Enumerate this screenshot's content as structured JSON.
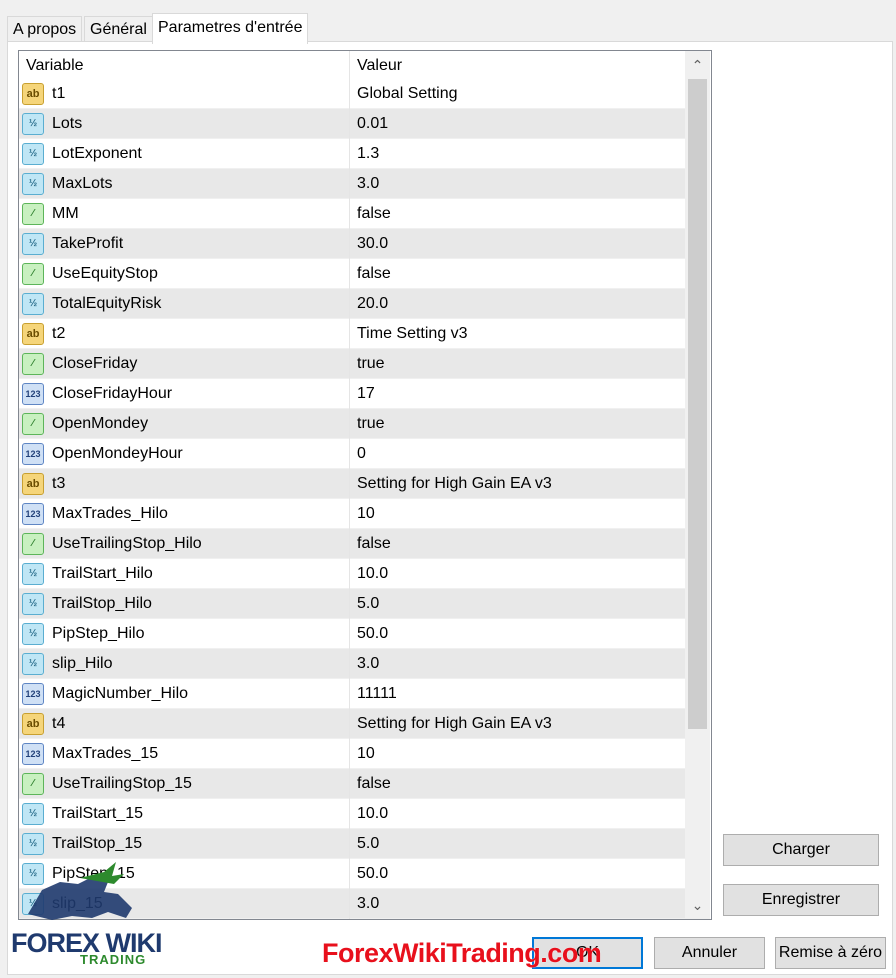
{
  "tabs": [
    {
      "label": "A propos"
    },
    {
      "label": "Général"
    },
    {
      "label": "Parametres d'entrée",
      "active": true
    }
  ],
  "grid": {
    "headers": {
      "variable": "Variable",
      "value": "Valeur"
    },
    "rows": [
      {
        "type": "string",
        "icon": "ab",
        "name": "t1",
        "value": "Global Setting"
      },
      {
        "type": "double",
        "icon": "½",
        "name": "Lots",
        "value": "0.01"
      },
      {
        "type": "double",
        "icon": "½",
        "name": "LotExponent",
        "value": "1.3"
      },
      {
        "type": "double",
        "icon": "½",
        "name": "MaxLots",
        "value": "3.0"
      },
      {
        "type": "bool",
        "icon": "⁄",
        "name": "MM",
        "value": "false"
      },
      {
        "type": "double",
        "icon": "½",
        "name": "TakeProfit",
        "value": "30.0"
      },
      {
        "type": "bool",
        "icon": "⁄",
        "name": "UseEquityStop",
        "value": "false"
      },
      {
        "type": "double",
        "icon": "½",
        "name": "TotalEquityRisk",
        "value": "20.0"
      },
      {
        "type": "string",
        "icon": "ab",
        "name": "t2",
        "value": "Time Setting v3"
      },
      {
        "type": "bool",
        "icon": "⁄",
        "name": "CloseFriday",
        "value": "true"
      },
      {
        "type": "int",
        "icon": "123",
        "name": "CloseFridayHour",
        "value": "17"
      },
      {
        "type": "bool",
        "icon": "⁄",
        "name": "OpenMondey",
        "value": "true"
      },
      {
        "type": "int",
        "icon": "123",
        "name": "OpenMondeyHour",
        "value": "0"
      },
      {
        "type": "string",
        "icon": "ab",
        "name": "t3",
        "value": "Setting for High Gain EA v3"
      },
      {
        "type": "int",
        "icon": "123",
        "name": "MaxTrades_Hilo",
        "value": "10"
      },
      {
        "type": "bool",
        "icon": "⁄",
        "name": "UseTrailingStop_Hilo",
        "value": "false"
      },
      {
        "type": "double",
        "icon": "½",
        "name": "TrailStart_Hilo",
        "value": "10.0"
      },
      {
        "type": "double",
        "icon": "½",
        "name": "TrailStop_Hilo",
        "value": "5.0"
      },
      {
        "type": "double",
        "icon": "½",
        "name": "PipStep_Hilo",
        "value": "50.0"
      },
      {
        "type": "double",
        "icon": "½",
        "name": "slip_Hilo",
        "value": "3.0"
      },
      {
        "type": "int",
        "icon": "123",
        "name": "MagicNumber_Hilo",
        "value": "11111"
      },
      {
        "type": "string",
        "icon": "ab",
        "name": "t4",
        "value": "Setting for High Gain EA v3"
      },
      {
        "type": "int",
        "icon": "123",
        "name": "MaxTrades_15",
        "value": "10"
      },
      {
        "type": "bool",
        "icon": "⁄",
        "name": "UseTrailingStop_15",
        "value": "false"
      },
      {
        "type": "double",
        "icon": "½",
        "name": "TrailStart_15",
        "value": "10.0"
      },
      {
        "type": "double",
        "icon": "½",
        "name": "TrailStop_15",
        "value": "5.0"
      },
      {
        "type": "double",
        "icon": "½",
        "name": "PipStep_15",
        "value": "50.0"
      },
      {
        "type": "double",
        "icon": "½",
        "name": "slip_15",
        "value": "3.0"
      }
    ],
    "scroll_position_fraction": 0.0
  },
  "buttons": {
    "load": "Charger",
    "save": "Enregistrer",
    "ok": "OK",
    "cancel": "Annuler",
    "reset": "Remise à zéro"
  },
  "watermark": {
    "site": "ForexWikiTrading.com",
    "logo_title": "FOREX WIKI",
    "logo_sub": "TRADING"
  }
}
